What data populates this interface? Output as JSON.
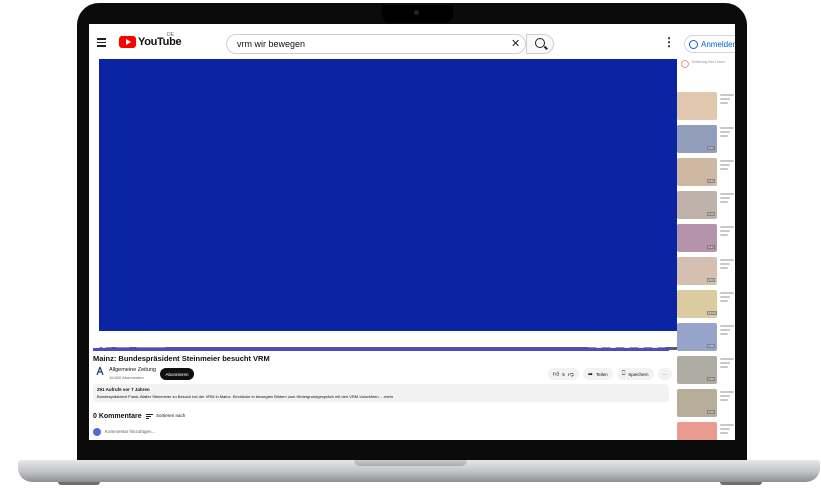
{
  "header": {
    "logo_text": "YouTube",
    "region": "DE",
    "search_value": "vrm wir bewegen",
    "clear_symbol": "✕",
    "more_symbol": "⋮",
    "signin_label": "Anmelden"
  },
  "player": {
    "background": "#0b24a3",
    "progress_fraction": 1.0
  },
  "video": {
    "title": "Mainz: Bundespräsident Steinmeier besucht VRM",
    "channel_name": "Allgemeine Zeitung",
    "channel_subs": "19.800 Abonnenten",
    "subscribe_label": "Abonnieren",
    "likes": "5",
    "share_label": "Teilen",
    "save_label": "Speichern",
    "more_label": "···"
  },
  "description": {
    "meta": "291 Aufrufe  vor 7 Jahren",
    "text": "Bundespräsident Frank-Walter Steinmeier zu Besuch bei der VRM in Mainz. Eindrücke in bewegten Bildern zum Hintergrundgespräch mit den VRM-Volontären.  ...mehr"
  },
  "comments": {
    "count_label": "0 Kommentare",
    "sort_label": "Sortieren nach",
    "input_placeholder": "Kommentar hinzufügen..."
  },
  "sidebar": {
    "top_text": "Erfahrung fürs Leben",
    "items": [
      {
        "color": "#c79a6b",
        "duration": ""
      },
      {
        "color": "#3a4f86",
        "duration": "3:01"
      },
      {
        "color": "#a77f5b",
        "duration": "3:41"
      },
      {
        "color": "#8c7468",
        "duration": "5:16"
      },
      {
        "color": "#7a3b6b",
        "duration": "4:47"
      },
      {
        "color": "#b28b73",
        "duration": "2:53"
      },
      {
        "color": "#c0a24f",
        "duration": "10:00"
      },
      {
        "color": "#3f5a9c",
        "duration": "2:58"
      },
      {
        "color": "#6e6a5b",
        "duration": "4:50"
      },
      {
        "color": "#7e6b4a",
        "duration": "9:22"
      },
      {
        "color": "#d84a36",
        "duration": ""
      }
    ]
  },
  "colors": {
    "accent_red": "#ff0000",
    "signin_blue": "#065fd4",
    "progress_purple": "#4d4bbf"
  }
}
